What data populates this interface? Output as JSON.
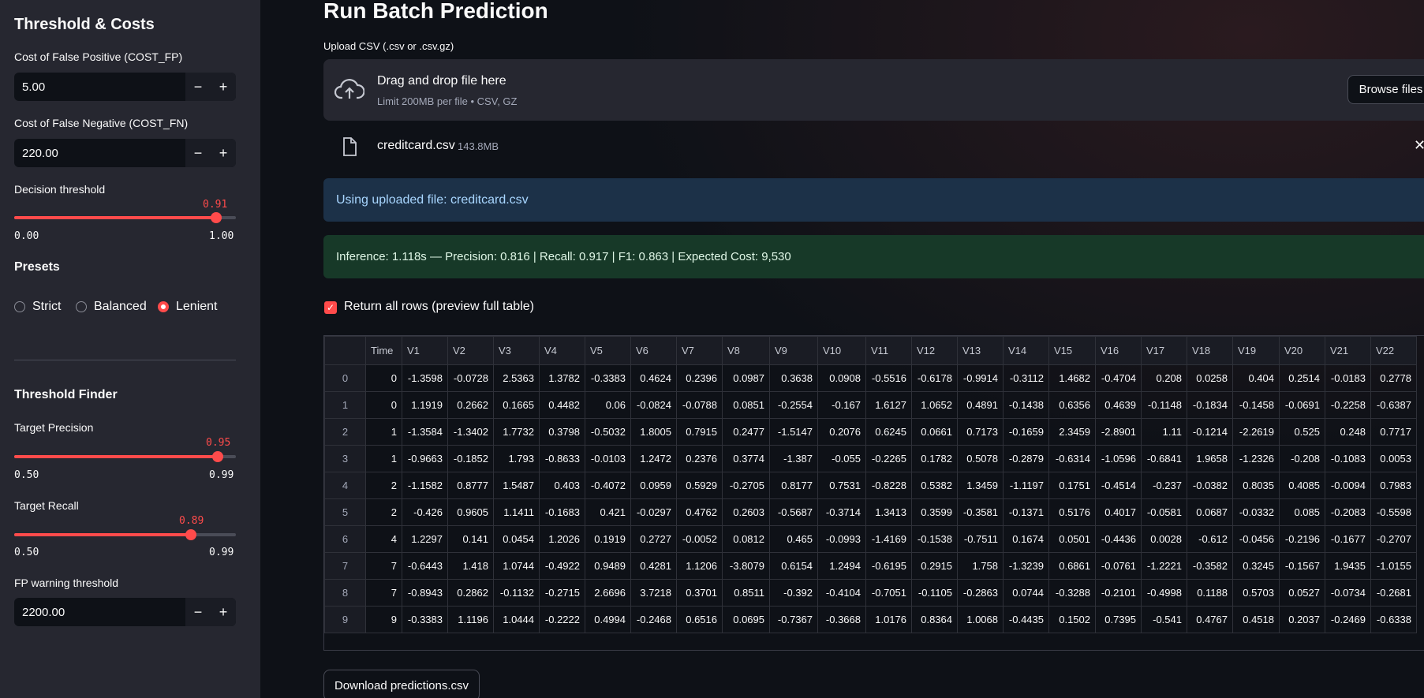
{
  "sidebar": {
    "section1_title": "Threshold & Costs",
    "cost_fp_label": "Cost of False Positive (COST_FP)",
    "cost_fp_value": "5.00",
    "cost_fn_label": "Cost of False Negative (COST_FN)",
    "cost_fn_value": "220.00",
    "minus": "−",
    "plus": "+",
    "decision_label": "Decision threshold",
    "decision_value": "0.91",
    "decision_min": "0.00",
    "decision_max": "1.00",
    "presets_title": "Presets",
    "presets": [
      "Strict",
      "Balanced",
      "Lenient"
    ],
    "preset_selected": "Lenient",
    "finder_title": "Threshold Finder",
    "target_precision_label": "Target Precision",
    "target_precision_value": "0.95",
    "target_precision_min": "0.50",
    "target_precision_max": "0.99",
    "target_recall_label": "Target Recall",
    "target_recall_value": "0.89",
    "target_recall_min": "0.50",
    "target_recall_max": "0.99",
    "fp_warn_label": "FP warning threshold",
    "fp_warn_value": "2200.00"
  },
  "main": {
    "title": "Run Batch Prediction",
    "upload_label": "Upload CSV (.csv or .csv.gz)",
    "drop_title": "Drag and drop file here",
    "drop_limit": "Limit 200MB per file • CSV, GZ",
    "browse_label": "Browse files",
    "file_name": "creditcard.csv",
    "file_size": "143.8MB",
    "info_text": "Using uploaded file: creditcard.csv",
    "success_text": "Inference: 1.118s — Precision: 0.816 | Recall: 0.917 | F1: 0.863 | Expected Cost: 9,530",
    "return_all_label": "Return all rows (preview full table)",
    "download_label": "Download predictions.csv"
  },
  "table": {
    "columns": [
      "",
      "Time",
      "V1",
      "V2",
      "V3",
      "V4",
      "V5",
      "V6",
      "V7",
      "V8",
      "V9",
      "V10",
      "V11",
      "V12",
      "V13",
      "V14",
      "V15",
      "V16",
      "V17",
      "V18",
      "V19",
      "V20",
      "V21",
      "V22"
    ],
    "rows": [
      [
        "0",
        "0",
        "-1.3598",
        "-0.0728",
        "2.5363",
        "1.3782",
        "-0.3383",
        "0.4624",
        "0.2396",
        "0.0987",
        "0.3638",
        "0.0908",
        "-0.5516",
        "-0.6178",
        "-0.9914",
        "-0.3112",
        "1.4682",
        "-0.4704",
        "0.208",
        "0.0258",
        "0.404",
        "0.2514",
        "-0.0183",
        "0.2778"
      ],
      [
        "1",
        "0",
        "1.1919",
        "0.2662",
        "0.1665",
        "0.4482",
        "0.06",
        "-0.0824",
        "-0.0788",
        "0.0851",
        "-0.2554",
        "-0.167",
        "1.6127",
        "1.0652",
        "0.4891",
        "-0.1438",
        "0.6356",
        "0.4639",
        "-0.1148",
        "-0.1834",
        "-0.1458",
        "-0.0691",
        "-0.2258",
        "-0.6387"
      ],
      [
        "2",
        "1",
        "-1.3584",
        "-1.3402",
        "1.7732",
        "0.3798",
        "-0.5032",
        "1.8005",
        "0.7915",
        "0.2477",
        "-1.5147",
        "0.2076",
        "0.6245",
        "0.0661",
        "0.7173",
        "-0.1659",
        "2.3459",
        "-2.8901",
        "1.11",
        "-0.1214",
        "-2.2619",
        "0.525",
        "0.248",
        "0.7717"
      ],
      [
        "3",
        "1",
        "-0.9663",
        "-0.1852",
        "1.793",
        "-0.8633",
        "-0.0103",
        "1.2472",
        "0.2376",
        "0.3774",
        "-1.387",
        "-0.055",
        "-0.2265",
        "0.1782",
        "0.5078",
        "-0.2879",
        "-0.6314",
        "-1.0596",
        "-0.6841",
        "1.9658",
        "-1.2326",
        "-0.208",
        "-0.1083",
        "0.0053"
      ],
      [
        "4",
        "2",
        "-1.1582",
        "0.8777",
        "1.5487",
        "0.403",
        "-0.4072",
        "0.0959",
        "0.5929",
        "-0.2705",
        "0.8177",
        "0.7531",
        "-0.8228",
        "0.5382",
        "1.3459",
        "-1.1197",
        "0.1751",
        "-0.4514",
        "-0.237",
        "-0.0382",
        "0.8035",
        "0.4085",
        "-0.0094",
        "0.7983"
      ],
      [
        "5",
        "2",
        "-0.426",
        "0.9605",
        "1.1411",
        "-0.1683",
        "0.421",
        "-0.0297",
        "0.4762",
        "0.2603",
        "-0.5687",
        "-0.3714",
        "1.3413",
        "0.3599",
        "-0.3581",
        "-0.1371",
        "0.5176",
        "0.4017",
        "-0.0581",
        "0.0687",
        "-0.0332",
        "0.085",
        "-0.2083",
        "-0.5598"
      ],
      [
        "6",
        "4",
        "1.2297",
        "0.141",
        "0.0454",
        "1.2026",
        "0.1919",
        "0.2727",
        "-0.0052",
        "0.0812",
        "0.465",
        "-0.0993",
        "-1.4169",
        "-0.1538",
        "-0.7511",
        "0.1674",
        "0.0501",
        "-0.4436",
        "0.0028",
        "-0.612",
        "-0.0456",
        "-0.2196",
        "-0.1677",
        "-0.2707"
      ],
      [
        "7",
        "7",
        "-0.6443",
        "1.418",
        "1.0744",
        "-0.4922",
        "0.9489",
        "0.4281",
        "1.1206",
        "-3.8079",
        "0.6154",
        "1.2494",
        "-0.6195",
        "0.2915",
        "1.758",
        "-1.3239",
        "0.6861",
        "-0.0761",
        "-1.2221",
        "-0.3582",
        "0.3245",
        "-0.1567",
        "1.9435",
        "-1.0155"
      ],
      [
        "8",
        "7",
        "-0.8943",
        "0.2862",
        "-0.1132",
        "-0.2715",
        "2.6696",
        "3.7218",
        "0.3701",
        "0.8511",
        "-0.392",
        "-0.4104",
        "-0.7051",
        "-0.1105",
        "-0.2863",
        "0.0744",
        "-0.3288",
        "-0.2101",
        "-0.4998",
        "0.1188",
        "0.5703",
        "0.0527",
        "-0.0734",
        "-0.2681"
      ],
      [
        "9",
        "9",
        "-0.3383",
        "1.1196",
        "1.0444",
        "-0.2222",
        "0.4994",
        "-0.2468",
        "0.6516",
        "0.0695",
        "-0.7367",
        "-0.3668",
        "1.0176",
        "0.8364",
        "1.0068",
        "-0.4435",
        "0.1502",
        "0.7395",
        "-0.541",
        "0.4767",
        "0.4518",
        "0.2037",
        "-0.2469",
        "-0.6338"
      ]
    ]
  },
  "colors": {
    "accent": "#ff4b4b",
    "sidebar": "#262730",
    "background": "#0e1117"
  },
  "icons": {
    "upload": "cloud-upload-icon",
    "file": "file-icon",
    "close": "close-icon"
  }
}
